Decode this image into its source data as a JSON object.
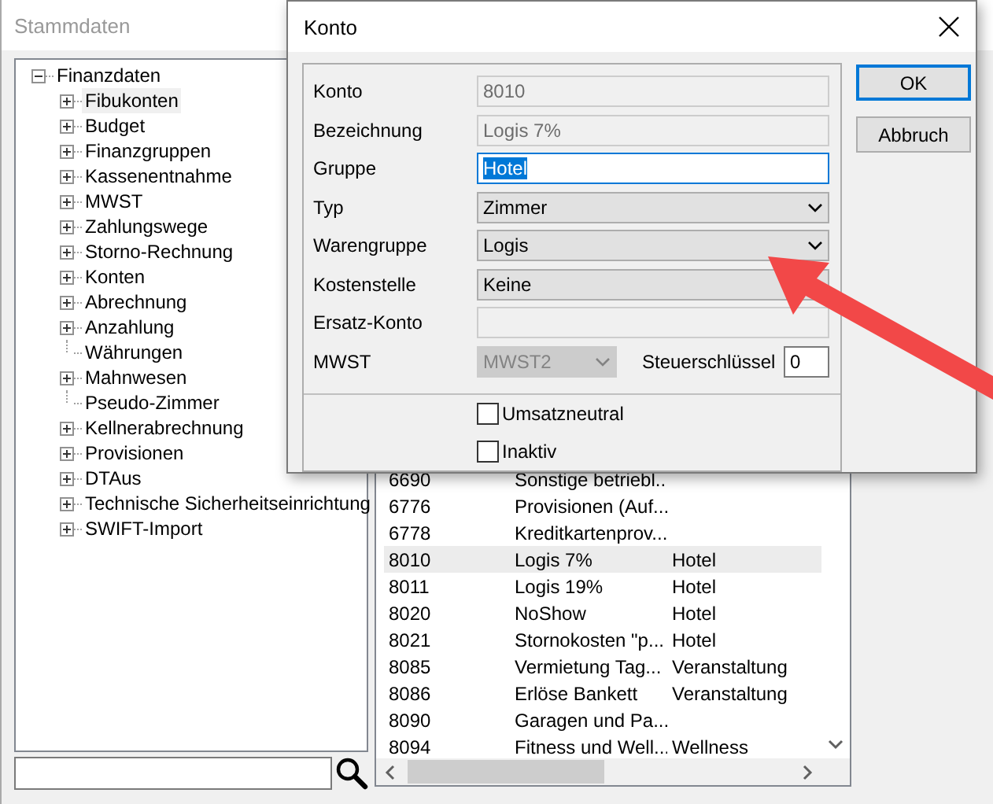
{
  "background_window": {
    "title": "Stammdaten"
  },
  "tree": [
    {
      "label": "Finanzdaten",
      "expandable": true,
      "expanded": true,
      "selected": false,
      "children": [
        {
          "label": "Fibukonten",
          "expandable": true,
          "selected": true
        },
        {
          "label": "Budget",
          "expandable": true,
          "selected": false
        },
        {
          "label": "Finanzgruppen",
          "expandable": true,
          "selected": false
        },
        {
          "label": "Kassenentnahme",
          "expandable": true,
          "selected": false
        },
        {
          "label": "MWST",
          "expandable": true,
          "selected": false
        },
        {
          "label": "Zahlungswege",
          "expandable": true,
          "selected": false
        },
        {
          "label": "Storno-Rechnung",
          "expandable": true,
          "selected": false
        },
        {
          "label": "Konten",
          "expandable": true,
          "selected": false
        },
        {
          "label": "Abrechnung",
          "expandable": true,
          "selected": false
        },
        {
          "label": "Anzahlung",
          "expandable": true,
          "selected": false
        },
        {
          "label": "Währungen",
          "expandable": false,
          "selected": false
        },
        {
          "label": "Mahnwesen",
          "expandable": true,
          "selected": false
        },
        {
          "label": "Pseudo-Zimmer",
          "expandable": false,
          "selected": false
        },
        {
          "label": "Kellnerabrechnung",
          "expandable": true,
          "selected": false
        },
        {
          "label": "Provisionen",
          "expandable": true,
          "selected": false
        },
        {
          "label": "DTAus",
          "expandable": true,
          "selected": false
        },
        {
          "label": "Technische Sicherheitseinrichtung",
          "expandable": true,
          "selected": false
        },
        {
          "label": "SWIFT-Import",
          "expandable": true,
          "selected": false
        }
      ]
    }
  ],
  "list": {
    "rows": [
      {
        "cells": [
          "6690",
          "Sonstige betriebl..."
        ],
        "selected": false
      },
      {
        "cells": [
          "6776",
          "Provisionen (Auf..."
        ],
        "selected": false
      },
      {
        "cells": [
          "6778",
          "Kreditkartenprov..."
        ],
        "selected": false
      },
      {
        "cells": [
          "8010",
          "Logis 7%",
          "Hotel"
        ],
        "selected": true
      },
      {
        "cells": [
          "8011",
          "Logis 19%",
          "Hotel"
        ],
        "selected": false
      },
      {
        "cells": [
          "8020",
          "NoShow",
          "Hotel"
        ],
        "selected": false
      },
      {
        "cells": [
          "8021",
          "Stornokosten \"p...",
          "Hotel"
        ],
        "selected": false
      },
      {
        "cells": [
          "8085",
          "Vermietung Tag...",
          "Veranstaltung"
        ],
        "selected": false
      },
      {
        "cells": [
          "8086",
          "Erlöse Bankett",
          "Veranstaltung"
        ],
        "selected": false
      },
      {
        "cells": [
          "8090",
          "Garagen und Pa..."
        ],
        "selected": false
      },
      {
        "cells": [
          "8094",
          "Fitness und Well...",
          "Wellness"
        ],
        "selected": false
      }
    ]
  },
  "dialog": {
    "title": "Konto",
    "fields": [
      {
        "label": "Konto",
        "kind": "text",
        "value": "8010",
        "disabled": true
      },
      {
        "label": "Bezeichnung",
        "kind": "text",
        "value": "Logis 7%",
        "disabled": true
      },
      {
        "label": "Gruppe",
        "kind": "text",
        "value": "Hotel",
        "disabled": false,
        "focused": true
      },
      {
        "label": "Typ",
        "kind": "dropdown",
        "value": "Zimmer",
        "disabled": false
      },
      {
        "label": "Warengruppe",
        "kind": "dropdown",
        "value": "Logis",
        "disabled": false
      },
      {
        "label": "Kostenstelle",
        "kind": "dropdown",
        "value": "Keine",
        "disabled": false
      },
      {
        "label": "Ersatz-Konto",
        "kind": "text",
        "disabled": true
      }
    ],
    "mwst": {
      "label": "MWST",
      "value": "MWST2",
      "disabled": true,
      "key_label": "Steuerschlüssel",
      "key_value": "0"
    },
    "checkboxes": [
      {
        "label": "Umsatzneutral",
        "checked": false
      },
      {
        "label": "Inaktiv",
        "checked": false
      }
    ],
    "buttons": [
      {
        "label": "OK",
        "default": true
      },
      {
        "label": "Abbruch",
        "default": false
      }
    ]
  }
}
